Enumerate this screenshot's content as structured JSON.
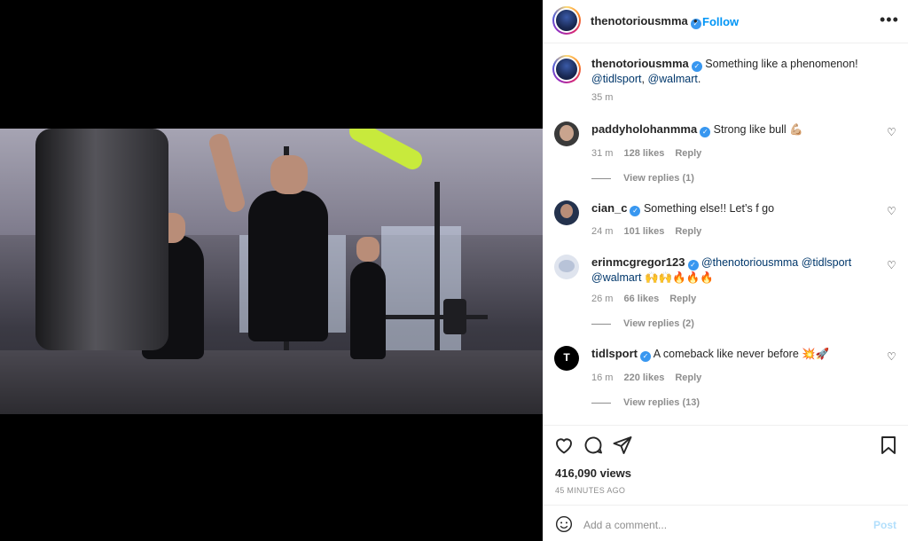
{
  "post": {
    "author": "thenotoriousmma",
    "follow_label": "Follow",
    "dot": "•",
    "more": "•••",
    "caption": {
      "username": "thenotoriousmma",
      "text": "Something like a phenomenon!",
      "mention1": "@tidlsport",
      "sep": ",",
      "mention2": "@walmart",
      "end": ".",
      "time": "35 m"
    }
  },
  "comments": [
    {
      "username": "paddyholohanmma",
      "text": "Strong like bull 💪🏼",
      "time": "31 m",
      "likes": "128 likes",
      "reply": "Reply",
      "view_replies": "View replies (1)"
    },
    {
      "username": "cian_c",
      "text": "Something else!! Let’s f go",
      "time": "24 m",
      "likes": "101 likes",
      "reply": "Reply"
    },
    {
      "username": "erinmcgregor123",
      "mention1": "@thenotoriousmma",
      "mention2": "@tidlsport",
      "mention3": "@walmart",
      "emojis": "🙌🙌🔥🔥🔥",
      "time": "26 m",
      "likes": "66 likes",
      "reply": "Reply",
      "view_replies": "View replies (2)"
    },
    {
      "username": "tidlsport",
      "text": "A comeback like never before 💥🚀",
      "time": "16 m",
      "likes": "220 likes",
      "reply": "Reply",
      "view_replies": "View replies (13)"
    }
  ],
  "stats": {
    "views": "416,090 views",
    "posted": "45 MINUTES AGO"
  },
  "composer": {
    "placeholder": "Add a comment...",
    "post_label": "Post"
  },
  "icons": {
    "like": "heart-icon",
    "comment": "comment-icon",
    "share": "share-icon",
    "save": "bookmark-icon",
    "emoji": "emoji-icon",
    "verified": "verified-badge-icon",
    "more": "more-options-icon"
  },
  "colors": {
    "accent": "#0095f6",
    "verified": "#3897f0",
    "post_disabled": "#b2dffc"
  }
}
